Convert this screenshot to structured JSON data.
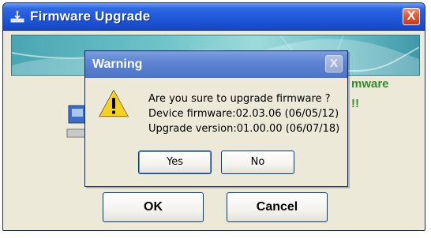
{
  "main_window": {
    "title": "Firmware Upgrade",
    "close_label": "X",
    "status_line_1": "mware",
    "status_line_2": "!!",
    "ok_label": "OK",
    "cancel_label": "Cancel"
  },
  "warning_dialog": {
    "title": "Warning",
    "close_label": "X",
    "message_lines": [
      "Are you sure to upgrade firmware ?",
      "Device firmware:02.03.06 (06/05/12)",
      "Upgrade version:01.00.00 (06/07/18)"
    ],
    "yes_label": "Yes",
    "no_label": "No"
  },
  "colors": {
    "titlebar_active": "#1e56d8",
    "titlebar_inactive": "#5e84d2",
    "status_green": "#2f8f2a",
    "close_red": "#e35a3a"
  },
  "icons": {
    "app": "firmware-icon",
    "warning": "warning-triangle-icon",
    "device": "device-icon"
  }
}
